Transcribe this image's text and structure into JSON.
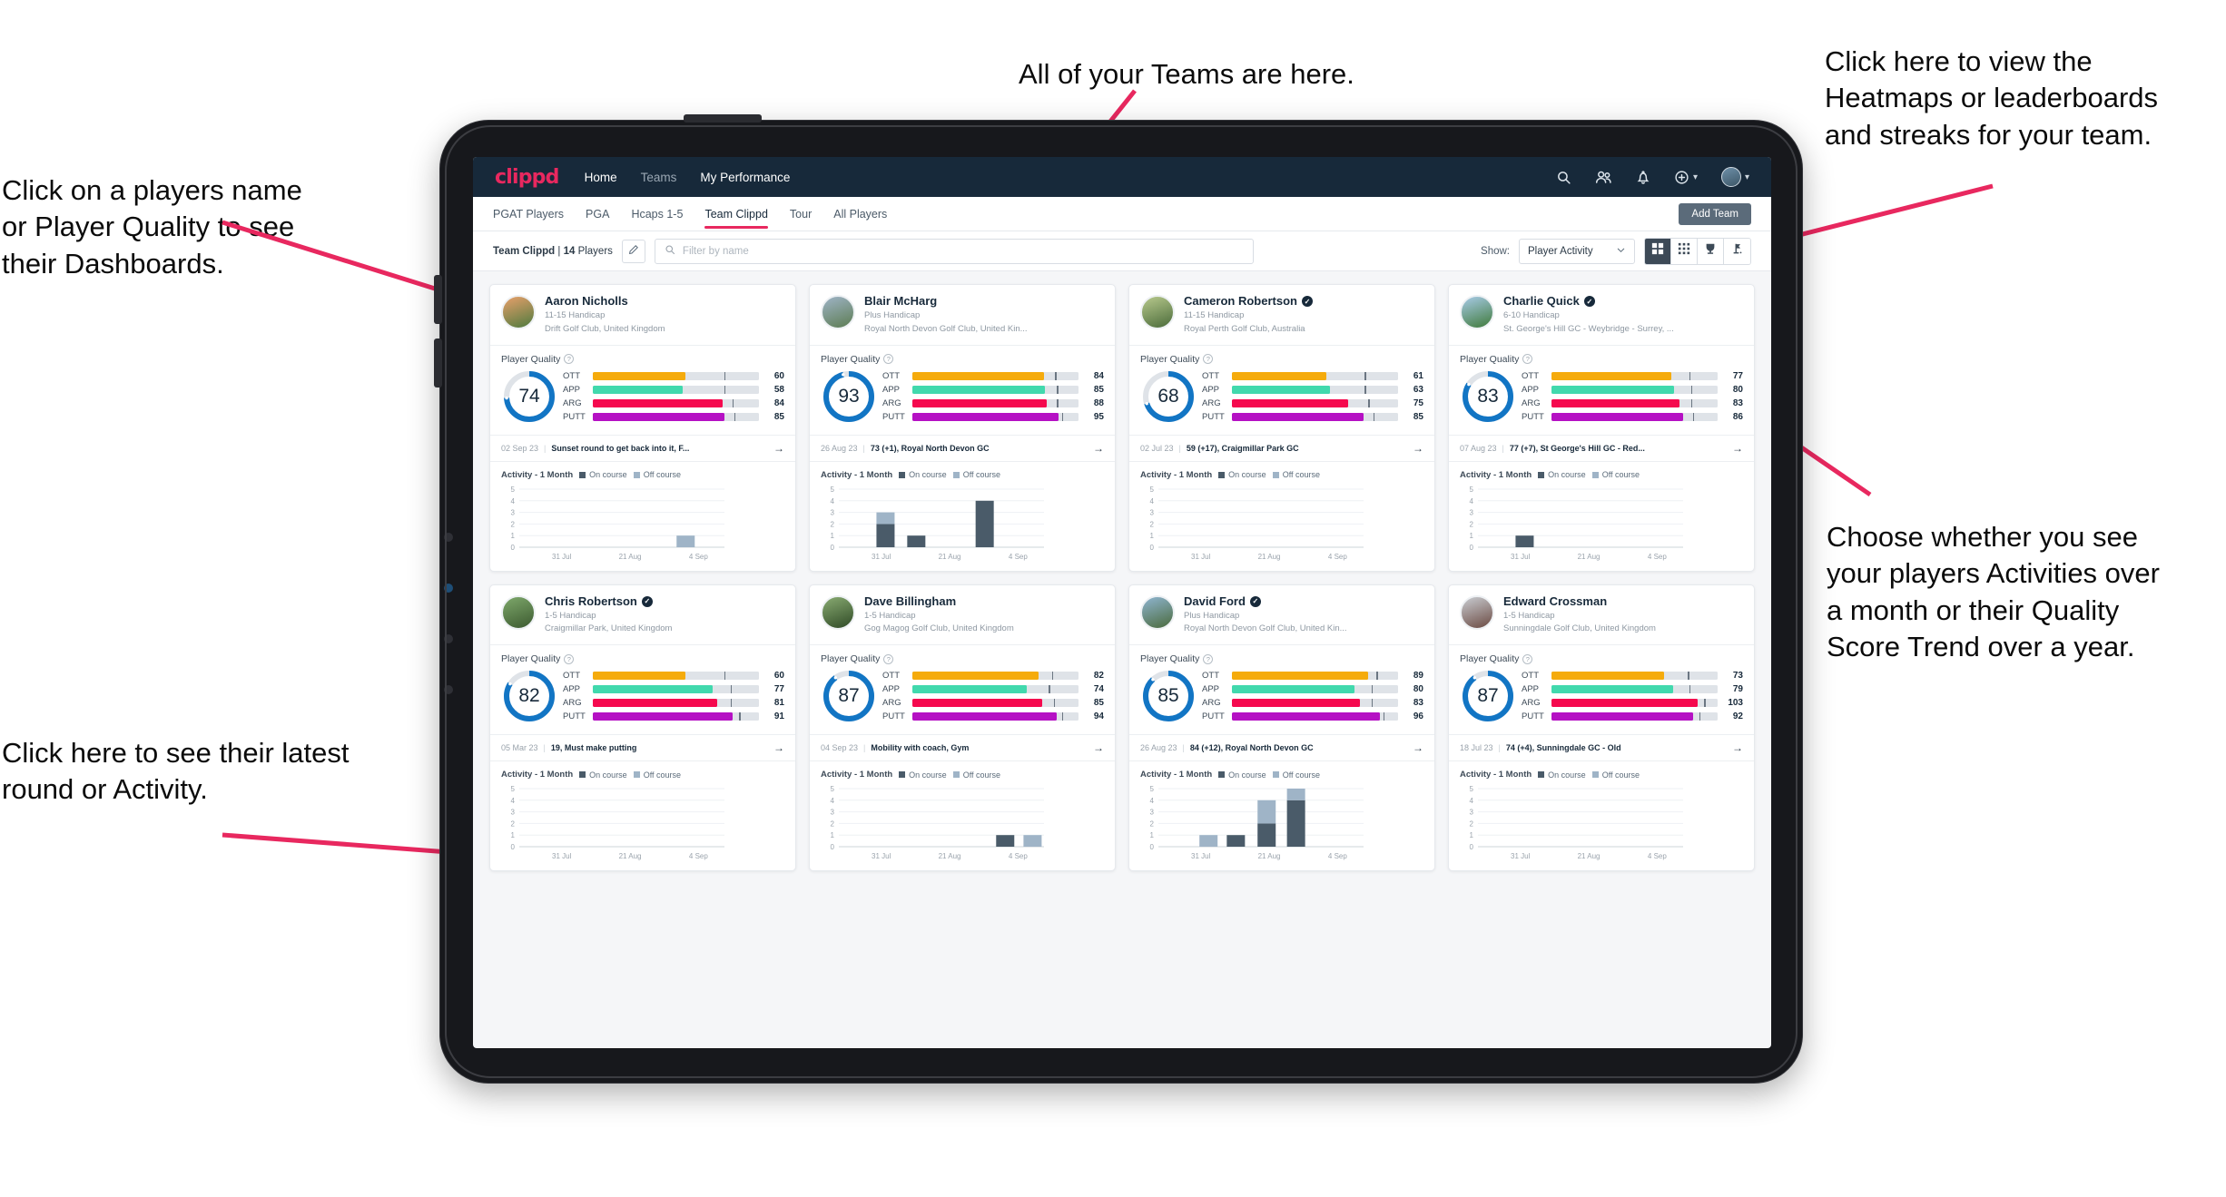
{
  "annotations": [
    {
      "id": "teams",
      "text": "All of your Teams are here."
    },
    {
      "id": "heatmaps",
      "text": "Click here to view the\nHeatmaps or leaderboards\nand streaks for your team."
    },
    {
      "id": "players-name",
      "text": "Click on a players name\nor Player Quality to see\ntheir Dashboards."
    },
    {
      "id": "show-toggle",
      "text": "Choose whether you see\nyour players Activities over\na month or their Quality\nScore Trend over a year."
    },
    {
      "id": "latest-round",
      "text": "Click here to see their latest\nround or Activity."
    }
  ],
  "topnav": {
    "brand": "clippd",
    "links": [
      {
        "label": "Home",
        "active": true
      },
      {
        "label": "Teams",
        "active": false
      },
      {
        "label": "My Performance",
        "active": true
      }
    ],
    "icons": [
      "search-icon",
      "people-icon",
      "bell-icon",
      "plus-circle-icon",
      "avatar"
    ]
  },
  "subtabs": {
    "items": [
      {
        "label": "PGAT Players",
        "active": false
      },
      {
        "label": "PGA",
        "active": false
      },
      {
        "label": "Hcaps 1-5",
        "active": false
      },
      {
        "label": "Team Clippd",
        "active": true
      },
      {
        "label": "Tour",
        "active": false
      },
      {
        "label": "All Players",
        "active": false
      }
    ],
    "add_team_label": "Add Team"
  },
  "filterbar": {
    "team_name": "Team Clippd",
    "separator": "|",
    "player_count": "14",
    "players_word": "Players",
    "edit_icon": "pencil-icon",
    "search_placeholder": "Filter by name",
    "search_value": "",
    "show_label": "Show:",
    "show_value": "Player Activity",
    "show_options": [
      "Player Activity",
      "Quality Score Trend"
    ],
    "view_buttons": [
      {
        "icon": "grid-large-icon",
        "active": true
      },
      {
        "icon": "grid-small-icon",
        "active": false
      },
      {
        "icon": "trophy-icon",
        "active": false
      },
      {
        "icon": "flag-icon",
        "active": false
      }
    ]
  },
  "card_labels": {
    "player_quality": "Player Quality",
    "help_icon": "question-mark-icon",
    "activity_title": "Activity - 1 Month",
    "legend_on": "On course",
    "legend_off": "Off course",
    "arrow_icon": "arrow-right-icon"
  },
  "colors": {
    "brand": "#e8285f",
    "navbar": "#17293a",
    "ring": "#1275c4",
    "ott": "#f5ab0c",
    "app": "#41d9ad",
    "arg": "#f5094e",
    "putt": "#b511c4",
    "on_course": "#4a5b69",
    "off_course": "#9fb4c7"
  },
  "chart_data": {
    "type": "bar",
    "title": "Activity - 1 Month",
    "xlabel": "",
    "ylabel": "",
    "ylim": [
      0,
      5
    ],
    "yticks": [
      0,
      1,
      2,
      3,
      4,
      5
    ],
    "xticks": [
      "31 Jul",
      "21 Aug",
      "4 Sep"
    ],
    "grid": true,
    "legend": [
      "On course",
      "Off course"
    ],
    "legend_position": "top"
  },
  "players": [
    {
      "name": "Aaron Nicholls",
      "verified": false,
      "handicap": "11-15 Handicap",
      "club": "Drift Golf Club, United Kingdom",
      "avatar_from": "#e8a06b",
      "avatar_to": "#4e7a3e",
      "quality": 74,
      "ring_pct": 74,
      "metrics": [
        {
          "label": "OTT",
          "value": 60,
          "fill_pct": 56,
          "tick_pct": 79,
          "color": "#f5ab0c"
        },
        {
          "label": "APP",
          "value": 58,
          "fill_pct": 54,
          "tick_pct": 79,
          "color": "#41d9ad"
        },
        {
          "label": "ARG",
          "value": 84,
          "fill_pct": 78,
          "tick_pct": 84,
          "color": "#f5094e"
        },
        {
          "label": "PUTT",
          "value": 85,
          "fill_pct": 79,
          "tick_pct": 85,
          "color": "#b511c4"
        }
      ],
      "last_date": "02 Sep 23",
      "last_text": "Sunset round to get back into it, F...",
      "bars": [
        {
          "x": 2.3,
          "on": 0,
          "off": 1
        }
      ]
    },
    {
      "name": "Blair McHarg",
      "verified": false,
      "handicap": "Plus Handicap",
      "club": "Royal North Devon Golf Club, United Kin...",
      "avatar_from": "#9fb4c7",
      "avatar_to": "#5c7c52",
      "quality": 93,
      "ring_pct": 96,
      "metrics": [
        {
          "label": "OTT",
          "value": 84,
          "fill_pct": 79,
          "tick_pct": 86,
          "color": "#f5ab0c"
        },
        {
          "label": "APP",
          "value": 85,
          "fill_pct": 80,
          "tick_pct": 87,
          "color": "#41d9ad"
        },
        {
          "label": "ARG",
          "value": 88,
          "fill_pct": 81,
          "tick_pct": 87,
          "color": "#f5094e"
        },
        {
          "label": "PUTT",
          "value": 95,
          "fill_pct": 88,
          "tick_pct": 90,
          "color": "#b511c4"
        }
      ],
      "last_date": "26 Aug 23",
      "last_text": "73 (+1), Royal North Devon GC",
      "bars": [
        {
          "x": 0.55,
          "on": 2,
          "off": 1
        },
        {
          "x": 1.0,
          "on": 1,
          "off": 0
        },
        {
          "x": 2.0,
          "on": 4,
          "off": 0
        }
      ]
    },
    {
      "name": "Cameron Robertson",
      "verified": true,
      "handicap": "11-15 Handicap",
      "club": "Royal Perth Golf Club, Australia",
      "avatar_from": "#b8c98d",
      "avatar_to": "#4a6b3a",
      "quality": 68,
      "ring_pct": 70,
      "metrics": [
        {
          "label": "OTT",
          "value": 61,
          "fill_pct": 57,
          "tick_pct": 80,
          "color": "#f5ab0c"
        },
        {
          "label": "APP",
          "value": 63,
          "fill_pct": 59,
          "tick_pct": 80,
          "color": "#41d9ad"
        },
        {
          "label": "ARG",
          "value": 75,
          "fill_pct": 70,
          "tick_pct": 82,
          "color": "#f5094e"
        },
        {
          "label": "PUTT",
          "value": 85,
          "fill_pct": 79,
          "tick_pct": 85,
          "color": "#b511c4"
        }
      ],
      "last_date": "02 Jul 23",
      "last_text": "59 (+17), Craigmillar Park GC",
      "bars": []
    },
    {
      "name": "Charlie Quick",
      "verified": true,
      "handicap": "6-10 Handicap",
      "club": "St. George's Hill GC - Weybridge - Surrey, ...",
      "avatar_from": "#a8cbe8",
      "avatar_to": "#3f7a3a",
      "quality": 83,
      "ring_pct": 84,
      "metrics": [
        {
          "label": "OTT",
          "value": 77,
          "fill_pct": 72,
          "tick_pct": 83,
          "color": "#f5ab0c"
        },
        {
          "label": "APP",
          "value": 80,
          "fill_pct": 74,
          "tick_pct": 84,
          "color": "#41d9ad"
        },
        {
          "label": "ARG",
          "value": 83,
          "fill_pct": 77,
          "tick_pct": 84,
          "color": "#f5094e"
        },
        {
          "label": "PUTT",
          "value": 86,
          "fill_pct": 79,
          "tick_pct": 85,
          "color": "#b511c4"
        }
      ],
      "last_date": "07 Aug 23",
      "last_text": "77 (+7), St George's Hill GC - Red...",
      "bars": [
        {
          "x": 0.55,
          "on": 1,
          "off": 0
        }
      ]
    },
    {
      "name": "Chris Robertson",
      "verified": true,
      "handicap": "1-5 Handicap",
      "club": "Craigmillar Park, United Kingdom",
      "avatar_from": "#7ea86b",
      "avatar_to": "#3c5a30",
      "quality": 82,
      "ring_pct": 84,
      "metrics": [
        {
          "label": "OTT",
          "value": 60,
          "fill_pct": 56,
          "tick_pct": 79,
          "color": "#f5ab0c"
        },
        {
          "label": "APP",
          "value": 77,
          "fill_pct": 72,
          "tick_pct": 83,
          "color": "#41d9ad"
        },
        {
          "label": "ARG",
          "value": 81,
          "fill_pct": 75,
          "tick_pct": 83,
          "color": "#f5094e"
        },
        {
          "label": "PUTT",
          "value": 91,
          "fill_pct": 84,
          "tick_pct": 88,
          "color": "#b511c4"
        }
      ],
      "last_date": "05 Mar 23",
      "last_text": "19, Must make putting",
      "bars": []
    },
    {
      "name": "Dave Billingham",
      "verified": false,
      "handicap": "1-5 Handicap",
      "club": "Gog Magog Golf Club, United Kingdom",
      "avatar_from": "#89ab72",
      "avatar_to": "#2f4a26",
      "quality": 87,
      "ring_pct": 90,
      "metrics": [
        {
          "label": "OTT",
          "value": 82,
          "fill_pct": 76,
          "tick_pct": 84,
          "color": "#f5ab0c"
        },
        {
          "label": "APP",
          "value": 74,
          "fill_pct": 69,
          "tick_pct": 82,
          "color": "#41d9ad"
        },
        {
          "label": "ARG",
          "value": 85,
          "fill_pct": 78,
          "tick_pct": 85,
          "color": "#f5094e"
        },
        {
          "label": "PUTT",
          "value": 94,
          "fill_pct": 87,
          "tick_pct": 90,
          "color": "#b511c4"
        }
      ],
      "last_date": "04 Sep 23",
      "last_text": "Mobility with coach, Gym",
      "bars": [
        {
          "x": 2.3,
          "on": 1,
          "off": 0
        },
        {
          "x": 2.7,
          "on": 0,
          "off": 1
        }
      ]
    },
    {
      "name": "David Ford",
      "verified": true,
      "handicap": "Plus Handicap",
      "club": "Royal North Devon Golf Club, United Kin...",
      "avatar_from": "#8fb5d1",
      "avatar_to": "#4a6a3c",
      "quality": 85,
      "ring_pct": 88,
      "metrics": [
        {
          "label": "OTT",
          "value": 89,
          "fill_pct": 82,
          "tick_pct": 87,
          "color": "#f5ab0c"
        },
        {
          "label": "APP",
          "value": 80,
          "fill_pct": 74,
          "tick_pct": 84,
          "color": "#41d9ad"
        },
        {
          "label": "ARG",
          "value": 83,
          "fill_pct": 77,
          "tick_pct": 84,
          "color": "#f5094e"
        },
        {
          "label": "PUTT",
          "value": 96,
          "fill_pct": 89,
          "tick_pct": 91,
          "color": "#b511c4"
        }
      ],
      "last_date": "26 Aug 23",
      "last_text": "84 (+12), Royal North Devon GC",
      "bars": [
        {
          "x": 0.6,
          "on": 0,
          "off": 1
        },
        {
          "x": 1.0,
          "on": 1,
          "off": 0
        },
        {
          "x": 1.45,
          "on": 2,
          "off": 2
        },
        {
          "x": 1.88,
          "on": 4,
          "off": 1
        }
      ]
    },
    {
      "name": "Edward Crossman",
      "verified": false,
      "handicap": "1-5 Handicap",
      "club": "Sunningdale Golf Club, United Kingdom",
      "avatar_from": "#c9cdd2",
      "avatar_to": "#6b4a42",
      "quality": 87,
      "ring_pct": 90,
      "metrics": [
        {
          "label": "OTT",
          "value": 73,
          "fill_pct": 68,
          "tick_pct": 82,
          "color": "#f5ab0c"
        },
        {
          "label": "APP",
          "value": 79,
          "fill_pct": 73,
          "tick_pct": 83,
          "color": "#41d9ad"
        },
        {
          "label": "ARG",
          "value": 103,
          "fill_pct": 88,
          "tick_pct": 92,
          "color": "#f5094e"
        },
        {
          "label": "PUTT",
          "value": 92,
          "fill_pct": 85,
          "tick_pct": 89,
          "color": "#b511c4"
        }
      ],
      "last_date": "18 Jul 23",
      "last_text": "74 (+4), Sunningdale GC - Old",
      "bars": []
    }
  ]
}
